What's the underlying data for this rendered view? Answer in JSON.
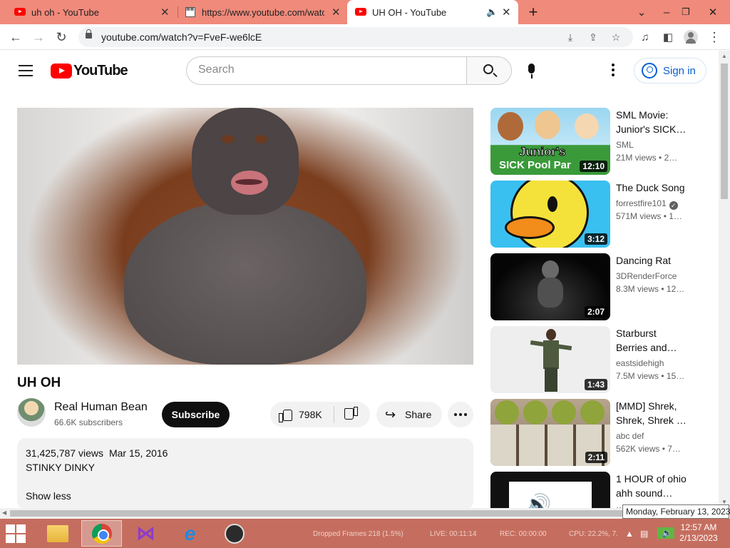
{
  "browser": {
    "tabs": [
      {
        "label": "uh oh - YouTube",
        "icon": "youtube-favicon"
      },
      {
        "label": "https://www.youtube.com/watch",
        "icon": "document-favicon"
      },
      {
        "label": "UH OH - YouTube",
        "icon": "youtube-favicon",
        "active": true,
        "audio": true
      }
    ],
    "new_tab": "+",
    "url": "youtube.com/watch?v=FveF-we6lcE"
  },
  "youtube": {
    "logo_text": "YouTube",
    "search_placeholder": "Search",
    "signin_label": "Sign in"
  },
  "video": {
    "title": "UH OH",
    "channel": "Real Human Bean",
    "subscribers": "66.6K subscribers",
    "subscribe_label": "Subscribe",
    "likes": "798K",
    "share_label": "Share",
    "views": "31,425,787 views",
    "date": "Mar 15, 2016",
    "description": "STINKY DINKY",
    "show_less": "Show less"
  },
  "recommendations": [
    {
      "title": "SML Movie: Junior's SICK…",
      "channel": "SML",
      "views": "21M views",
      "age": "2…",
      "duration": "12:10",
      "thumb_text_1": "Junior's",
      "thumb_text_2": "SICK Pool Par"
    },
    {
      "title": "The Duck Song",
      "channel": "forrestfire101",
      "verified": true,
      "views": "571M views",
      "age": "1…",
      "duration": "3:12"
    },
    {
      "title": "Dancing Rat",
      "channel": "3DRenderForce",
      "views": "8.3M views",
      "age": "12…",
      "duration": "2:07"
    },
    {
      "title": "Starburst Berries and…",
      "channel": "eastsidehigh",
      "views": "7.5M views",
      "age": "15…",
      "duration": "1:43"
    },
    {
      "title": "[MMD] Shrek, Shrek, Shrek …",
      "channel": "abc def",
      "views": "562K views",
      "age": "7…",
      "duration": "2:11"
    },
    {
      "title": "1 HOUR of ohio ahh sound…",
      "channel": "…",
      "views": "",
      "age": "",
      "duration": ""
    }
  ],
  "taskbar": {
    "apps": [
      "file-explorer",
      "chrome",
      "visual-studio",
      "internet-explorer",
      "obs-studio"
    ],
    "obs_dropped": "Dropped Frames 218 (1.5%)",
    "obs_live": "LIVE: 00:11:14",
    "obs_rec": "REC: 00:00:00",
    "obs_cpu": "CPU: 22.2%, 7.",
    "time": "12:57 AM",
    "date": "2/13/2023",
    "tooltip": "Monday, February 13, 2023"
  }
}
